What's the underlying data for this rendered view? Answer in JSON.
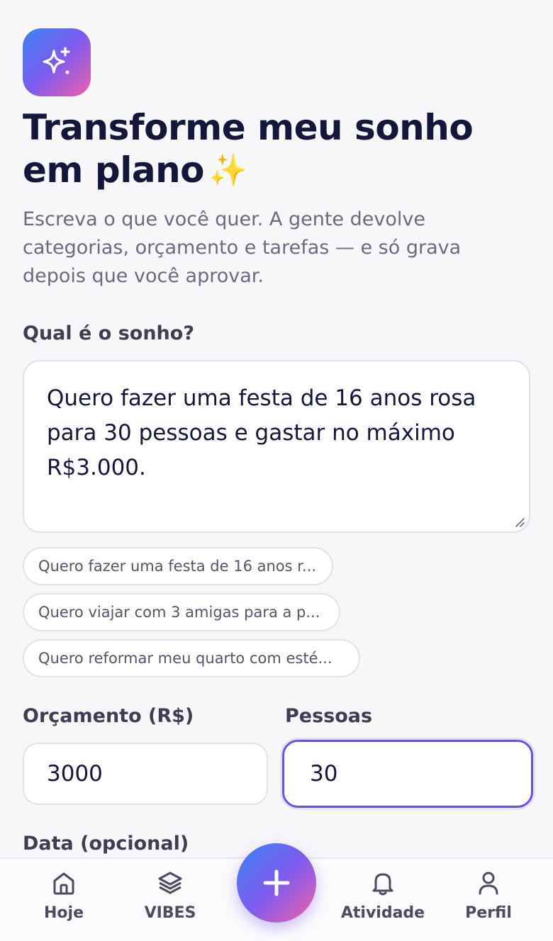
{
  "header": {
    "app_icon": "sparkles-icon",
    "title": "Transforme meu sonho em plano",
    "title_emoji": "✨",
    "subtitle": "Escreva o que você quer. A gente devolve categorias, orçamento e tarefas — e só grava depois que você aprovar."
  },
  "form": {
    "dream_label": "Qual é o sonho?",
    "dream_value": "Quero fazer uma festa de 16 anos rosa para 30 pessoas e gastar no máximo R$3.000.",
    "suggestions": [
      "Quero fazer uma festa de 16 anos r...",
      "Quero viajar com 3 amigas para a p...",
      "Quero reformar meu quarto com esté..."
    ],
    "budget_label": "Orçamento (R$)",
    "budget_value": "3000",
    "people_label": "Pessoas",
    "people_value": "30",
    "date_label": "Data (opcional)"
  },
  "nav": {
    "items": [
      {
        "label": "Hoje",
        "icon": "home-icon"
      },
      {
        "label": "VIBES",
        "icon": "layers-icon"
      },
      {
        "label": "Atividade",
        "icon": "bell-icon"
      },
      {
        "label": "Perfil",
        "icon": "user-icon"
      }
    ],
    "fab_icon": "plus-icon"
  },
  "colors": {
    "accent": "#6c4ee8",
    "gradient_start": "#3b82f6",
    "gradient_end": "#f25fa9",
    "text_dark": "#15173a",
    "text_muted": "#6b6a7e"
  }
}
